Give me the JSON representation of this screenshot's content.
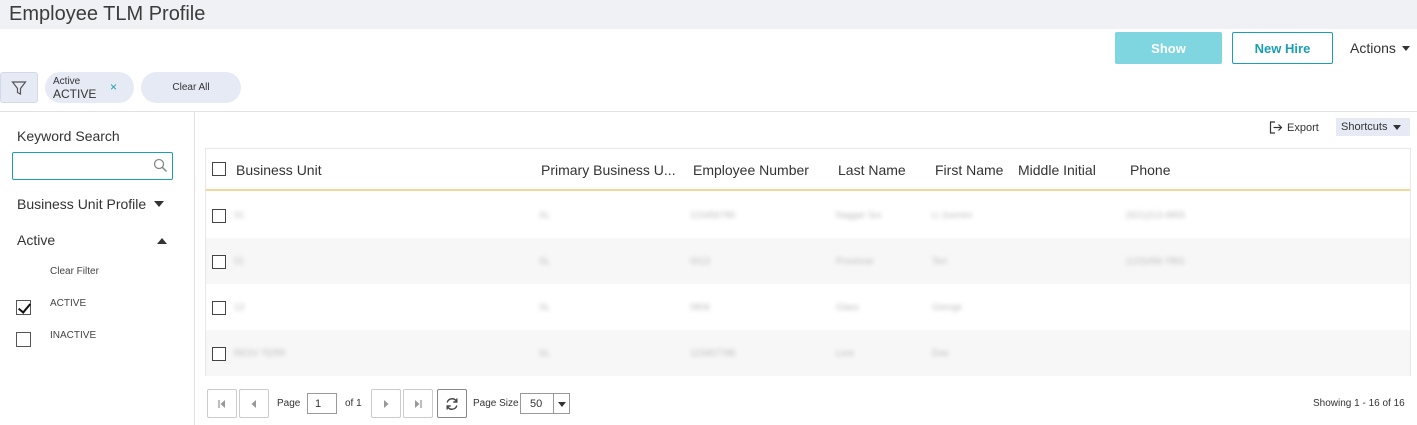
{
  "page": {
    "title": "Employee TLM Profile"
  },
  "toolbar": {
    "show_label": "Show",
    "new_hire_label": "New Hire",
    "actions_label": "Actions"
  },
  "filters": {
    "chip": {
      "label": "Active",
      "value": "ACTIVE",
      "remove": "×"
    },
    "clear_all": "Clear All"
  },
  "sidebar": {
    "keyword_search": "Keyword Search",
    "keyword_value": "",
    "business_unit_profile": "Business Unit Profile",
    "active_section": "Active",
    "clear_filter": "Clear Filter",
    "options": [
      {
        "label": "ACTIVE",
        "checked": true
      },
      {
        "label": "INACTIVE",
        "checked": false
      }
    ]
  },
  "grid_tools": {
    "export": "Export",
    "shortcuts": "Shortcuts"
  },
  "table": {
    "columns": [
      "Business Unit",
      "Primary Business U...",
      "Employee Number",
      "Last Name",
      "First Name",
      "Middle Initial",
      "Phone"
    ],
    "rows": [
      [
        "01",
        "SL",
        "123456789",
        "Nagger Sui",
        "Li Jusmini",
        "",
        "(921)213-4855"
      ],
      [
        "01",
        "SL",
        "0013",
        "Provincer",
        "Teri",
        "",
        "(123)456-7891"
      ],
      [
        "13",
        "SL",
        "0806",
        "Glass",
        "George",
        "",
        ""
      ],
      [
        "RESV TERR",
        "SL",
        "123457788",
        "Lore",
        "Doe",
        "",
        ""
      ]
    ]
  },
  "pager": {
    "page_label": "Page",
    "page_value": "1",
    "of_label": "of 1",
    "page_size_label": "Page Size",
    "page_size_value": "50",
    "showing": "Showing 1 - 16 of 16"
  },
  "colors": {
    "accent": "#1a9fb5",
    "show_button": "#7fd5e0",
    "chip_bg": "#e6eaf5",
    "header_rule": "#f4d79a"
  }
}
